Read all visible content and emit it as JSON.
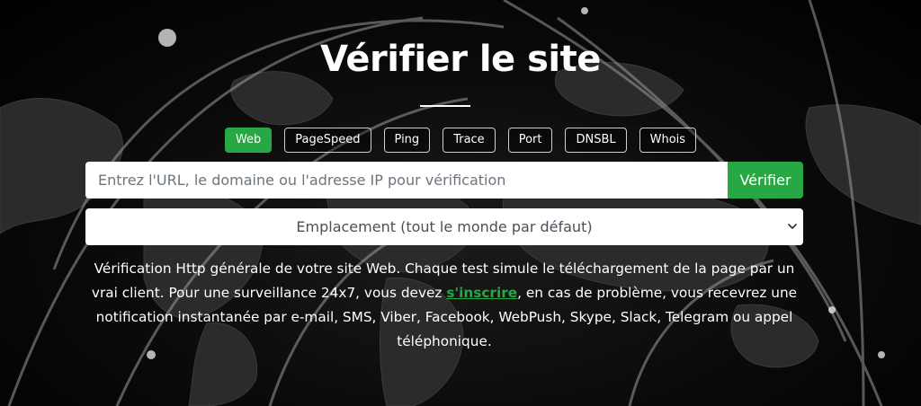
{
  "hero": {
    "title": "Vérifier le site"
  },
  "tabs": [
    {
      "label": "Web",
      "active": true
    },
    {
      "label": "PageSpeed",
      "active": false
    },
    {
      "label": "Ping",
      "active": false
    },
    {
      "label": "Trace",
      "active": false
    },
    {
      "label": "Port",
      "active": false
    },
    {
      "label": "DNSBL",
      "active": false
    },
    {
      "label": "Whois",
      "active": false
    }
  ],
  "search": {
    "placeholder": "Entrez l'URL, le domaine ou l'adresse IP pour vérification",
    "value": "",
    "button_label": "Vérifier"
  },
  "location": {
    "selected": "Emplacement (tout le monde par défaut)"
  },
  "description": {
    "before_link": "Vérification Http générale de votre site Web. Chaque test simule le téléchargement de la page par un vrai client. Pour une surveillance 24x7, vous devez ",
    "link_text": "s'inscrire",
    "after_link": ", en cas de problème, vous recevrez une notification instantanée par e-mail, SMS, Viber, Facebook, WebPush, Skype, Slack, Telegram ou appel téléphonique."
  },
  "colors": {
    "accent": "#28a745",
    "background": "#000000",
    "text": "#ffffff"
  }
}
